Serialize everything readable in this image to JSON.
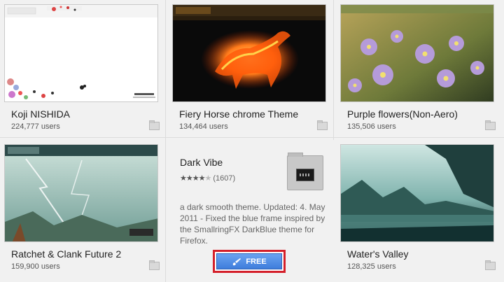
{
  "tiles": [
    {
      "title": "Koji NISHIDA",
      "users": "224,777 users"
    },
    {
      "title": "Fiery Horse chrome Theme",
      "users": "134,464 users"
    },
    {
      "title": "Purple flowers(Non-Aero)",
      "users": "135,506 users"
    },
    {
      "title": "Ratchet & Clank Future 2",
      "users": "159,900 users"
    },
    {
      "title": "Water's Valley",
      "users": "128,325 users"
    }
  ],
  "expanded": {
    "title": "Dark Vibe",
    "rating_count": "(1607)",
    "rating_value": 4.5,
    "description": "a dark smooth theme. Updated: 4. May 2011 - Fixed the blue frame inspired by the SmallringFX DarkBlue theme for Firefox.",
    "button_label": "FREE"
  },
  "icons": {
    "folder": "folder-icon",
    "brush": "paintbrush-icon",
    "star": "star-icon"
  }
}
